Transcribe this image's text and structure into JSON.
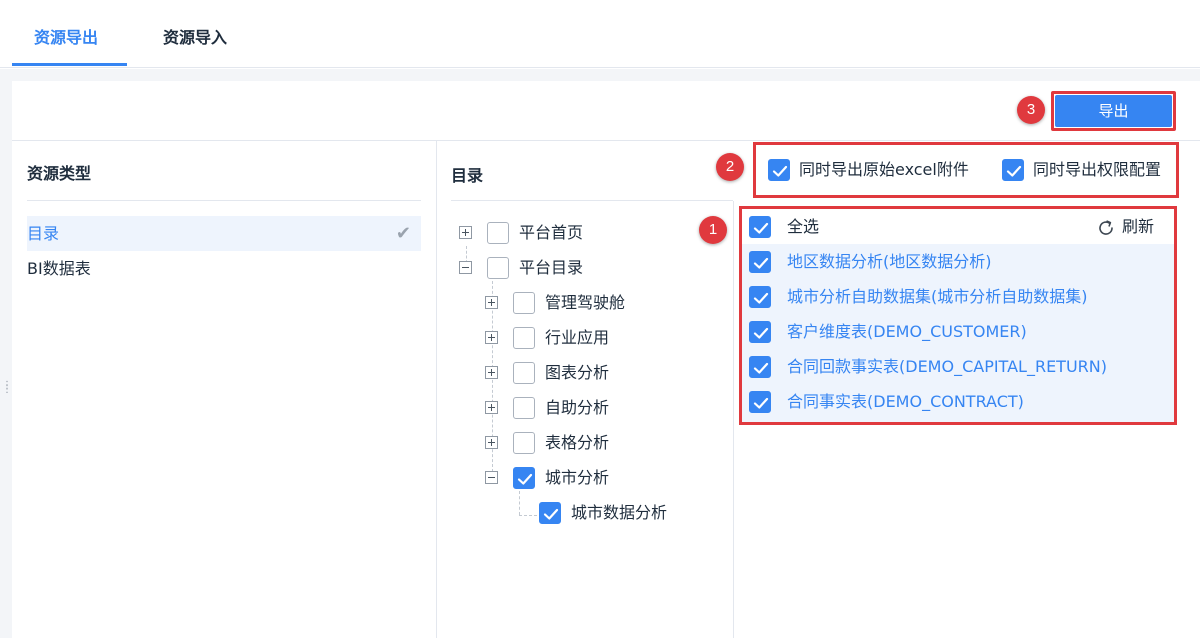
{
  "tabs": [
    {
      "label": "资源导出",
      "active": true
    },
    {
      "label": "资源导入",
      "active": false
    }
  ],
  "toolbar": {
    "export_label": "导出"
  },
  "badges": [
    "1",
    "2",
    "3"
  ],
  "resource_type": {
    "title": "资源类型",
    "items": [
      {
        "label": "目录",
        "active": true
      },
      {
        "label": "BI数据表",
        "active": false
      }
    ]
  },
  "directory": {
    "title": "目录",
    "nodes": [
      {
        "label": "平台首页",
        "checked": false,
        "expander": "plus"
      },
      {
        "label": "平台目录",
        "checked": false,
        "expander": "minus"
      },
      {
        "label": "管理驾驶舱",
        "checked": false,
        "expander": "plus"
      },
      {
        "label": "行业应用",
        "checked": false,
        "expander": "plus"
      },
      {
        "label": "图表分析",
        "checked": false,
        "expander": "plus"
      },
      {
        "label": "自助分析",
        "checked": false,
        "expander": "plus"
      },
      {
        "label": "表格分析",
        "checked": false,
        "expander": "plus"
      },
      {
        "label": "城市分析",
        "checked": true,
        "expander": "minus"
      },
      {
        "label": "城市数据分析",
        "checked": true,
        "expander": "none"
      }
    ]
  },
  "options": {
    "excel_attachment": "同时导出原始excel附件",
    "permission_config": "同时导出权限配置"
  },
  "list": {
    "select_all": "全选",
    "refresh": "刷新",
    "items": [
      "地区数据分析(地区数据分析)",
      "城市分析自助数据集(城市分析自助数据集)",
      "客户维度表(DEMO_CUSTOMER)",
      "合同回款事实表(DEMO_CAPITAL_RETURN)",
      "合同事实表(DEMO_CONTRACT)"
    ]
  },
  "colors": {
    "accent": "#3685f2",
    "highlight": "#e0393e"
  }
}
